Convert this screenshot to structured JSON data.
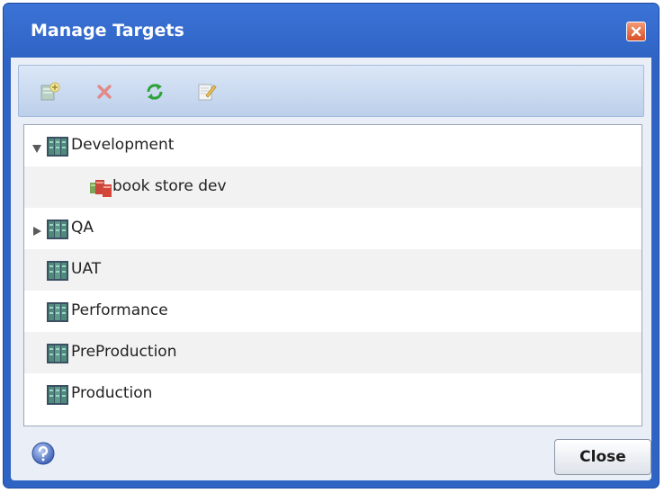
{
  "dialog": {
    "title": "Manage Targets",
    "close_button_label": "Close"
  },
  "toolbar": {
    "buttons": [
      {
        "icon": "add-target-icon"
      },
      {
        "icon": "delete-icon"
      },
      {
        "icon": "refresh-icon"
      },
      {
        "icon": "edit-icon"
      }
    ]
  },
  "tree": {
    "items": [
      {
        "label": "Development",
        "expanded": true,
        "icon": "server-group-icon"
      },
      {
        "label": "book store dev",
        "icon": "target-icon"
      },
      {
        "label": "QA",
        "expanded": false,
        "icon": "server-group-icon"
      },
      {
        "label": "UAT",
        "icon": "server-group-icon"
      },
      {
        "label": "Performance",
        "icon": "server-group-icon"
      },
      {
        "label": "PreProduction",
        "icon": "server-group-icon"
      },
      {
        "label": "Production",
        "icon": "server-group-icon"
      }
    ]
  },
  "colors": {
    "titlebar": "#2f64c4",
    "close_icon": "#d94f25"
  }
}
